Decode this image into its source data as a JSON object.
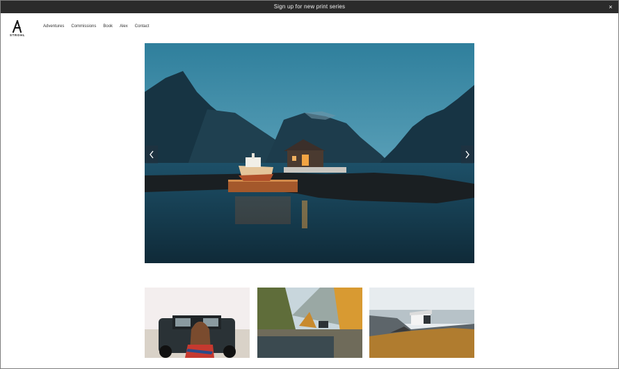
{
  "banner": {
    "text": "Sign up for new print series",
    "close_glyph": "×"
  },
  "brand": {
    "logo_text": "STROHL",
    "logo_icon": "a-logo-icon"
  },
  "nav": {
    "items": [
      {
        "label": "Adventures"
      },
      {
        "label": "Commissions"
      },
      {
        "label": "Book"
      },
      {
        "label": "Alex"
      },
      {
        "label": "Contact"
      }
    ]
  },
  "slideshow": {
    "prev_icon": "chevron-left-icon",
    "next_icon": "chevron-right-icon"
  },
  "colors": {
    "banner_bg": "#2b2b2b",
    "hero_sky": "#3f8aa6",
    "hero_water": "#173746"
  }
}
